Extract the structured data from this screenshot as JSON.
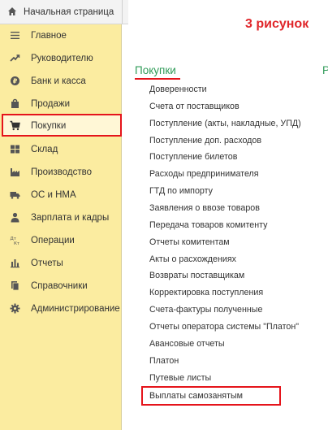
{
  "colors": {
    "sidebar_bg": "#fbeca0",
    "section_title": "#2f9b58",
    "annotation": "#e0262a",
    "highlight_border": "#e5141b"
  },
  "header": {
    "home_tab_label": "Начальная страница",
    "home_icon": "home-icon"
  },
  "annotation_text": "3 рисунок",
  "sidebar": {
    "items": [
      {
        "label": "Главное",
        "icon": "menu-lines-icon"
      },
      {
        "label": "Руководителю",
        "icon": "trend-up-icon"
      },
      {
        "label": "Банк и касса",
        "icon": "coin-icon"
      },
      {
        "label": "Продажи",
        "icon": "shopping-bag-icon"
      },
      {
        "label": "Покупки",
        "icon": "shopping-cart-icon"
      },
      {
        "label": "Склад",
        "icon": "warehouse-grid-icon"
      },
      {
        "label": "Производство",
        "icon": "factory-icon"
      },
      {
        "label": "ОС и НМА",
        "icon": "truck-icon"
      },
      {
        "label": "Зарплата и кадры",
        "icon": "person-icon"
      },
      {
        "label": "Операции",
        "icon": "dt-kt-icon"
      },
      {
        "label": "Отчеты",
        "icon": "bar-chart-icon"
      },
      {
        "label": "Справочники",
        "icon": "books-icon"
      },
      {
        "label": "Администрирование",
        "icon": "gear-icon"
      }
    ],
    "selected": "Покупки"
  },
  "main": {
    "section_title": "Покупки",
    "cut_next_title": "Р",
    "items": [
      "Доверенности",
      "Счета от поставщиков",
      "Поступление (акты, накладные, УПД)",
      "Поступление доп. расходов",
      "Поступление билетов",
      "Расходы предпринимателя",
      "ГТД по импорту",
      "Заявления о ввозе товаров",
      "Передача товаров комитенту",
      "Отчеты комитентам",
      "Акты о расхождениях",
      "Возвраты поставщикам",
      "Корректировка поступления",
      "Счета-фактуры полученные",
      "Отчеты оператора системы \"Платон\"",
      "Авансовые отчеты",
      "Платон",
      "Путевые листы",
      "Выплаты самозанятым"
    ],
    "highlighted_item": "Выплаты самозанятым"
  }
}
